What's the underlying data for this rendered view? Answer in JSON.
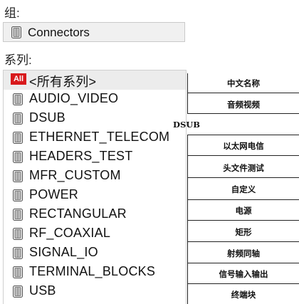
{
  "group_label": "组:",
  "group_value": "Connectors",
  "series_label": "系列:",
  "all_badge": "All",
  "series": [
    "<所有系列>",
    "AUDIO_VIDEO",
    "DSUB",
    "ETHERNET_TELECOM",
    "HEADERS_TEST",
    "MFR_CUSTOM",
    "POWER",
    "RECTANGULAR",
    "RF_COAXIAL",
    "SIGNAL_IO",
    "TERMINAL_BLOCKS",
    "USB"
  ],
  "translations": [
    "中文名称",
    "音频视频",
    "DSUB",
    "以太网电信",
    "头文件测试",
    "自定义",
    "电源",
    "矩形",
    "射频同轴",
    "信号输入输出",
    "终端块"
  ],
  "icons": {
    "library": "library-book-icon",
    "all": "all-badge-icon"
  },
  "colors": {
    "all_badge": "#d8191c",
    "selected_row": "#ececec"
  }
}
